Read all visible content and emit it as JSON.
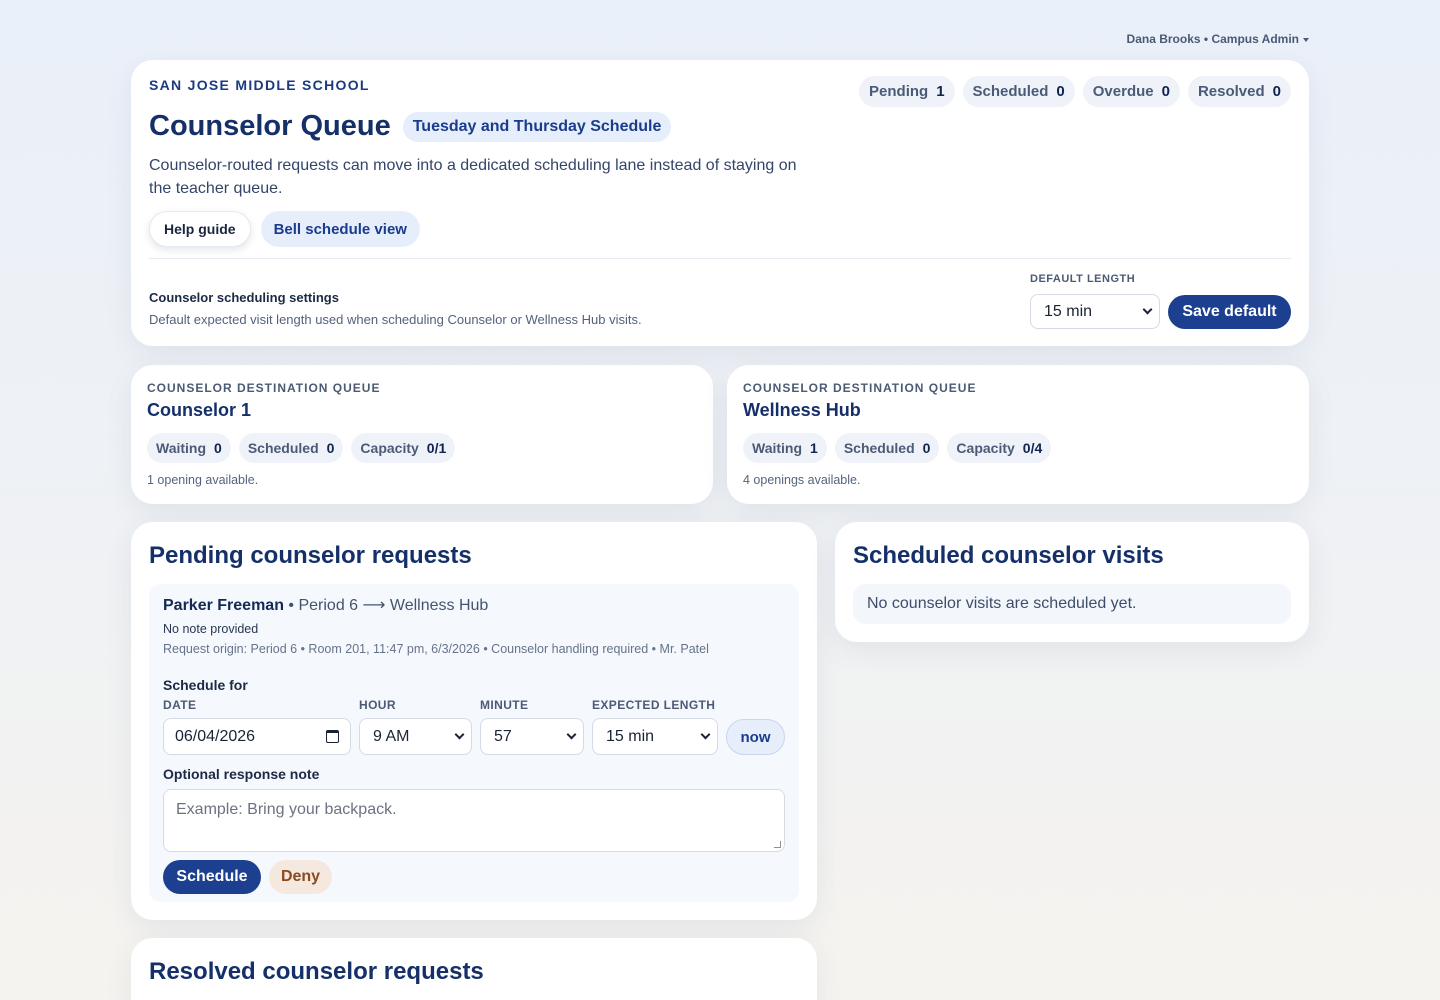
{
  "user_menu": {
    "label": "Dana Brooks • Campus Admin"
  },
  "header": {
    "school": "SAN JOSE MIDDLE SCHOOL",
    "title": "Counselor Queue",
    "schedule_pill": "Tuesday and Thursday Schedule",
    "description": "Counselor-routed requests can move into a dedicated scheduling lane instead of staying on the teacher queue.",
    "help_button": "Help guide",
    "bell_button": "Bell schedule view",
    "stats": [
      {
        "label": "Pending",
        "value": "1"
      },
      {
        "label": "Scheduled",
        "value": "0"
      },
      {
        "label": "Overdue",
        "value": "0"
      },
      {
        "label": "Resolved",
        "value": "0"
      }
    ]
  },
  "settings": {
    "title": "Counselor scheduling settings",
    "description": "Default expected visit length used when scheduling Counselor or Wellness Hub visits.",
    "default_length_label": "DEFAULT LENGTH",
    "default_length_value": "15 min",
    "save_button": "Save default"
  },
  "destinations": [
    {
      "kicker": "COUNSELOR DESTINATION QUEUE",
      "name": "Counselor 1",
      "chips": [
        {
          "label": "Waiting",
          "value": "0"
        },
        {
          "label": "Scheduled",
          "value": "0"
        },
        {
          "label": "Capacity",
          "value": "0/1"
        }
      ],
      "note": "1 opening available."
    },
    {
      "kicker": "COUNSELOR DESTINATION QUEUE",
      "name": "Wellness Hub",
      "chips": [
        {
          "label": "Waiting",
          "value": "1"
        },
        {
          "label": "Scheduled",
          "value": "0"
        },
        {
          "label": "Capacity",
          "value": "0/4"
        }
      ],
      "note": "4 openings available."
    }
  ],
  "pending": {
    "title": "Pending counselor requests",
    "request": {
      "student": "Parker Freeman",
      "route": " • Period 6 ⟶ Wellness Hub",
      "note": "No note provided",
      "origin": "Request origin: Period 6 • Room 201, 11:47 pm, 6/3/2026 • Counselor handling required • Mr. Patel",
      "schedule_label": "Schedule for",
      "date_label": "DATE",
      "date_value": "06/04/2026",
      "hour_label": "HOUR",
      "hour_value": "9 AM",
      "minute_label": "MINUTE",
      "minute_value": "57",
      "length_label": "EXPECTED LENGTH",
      "length_value": "15 min",
      "now_button": "now",
      "note_label": "Optional response note",
      "note_placeholder": "Example: Bring your backpack.",
      "schedule_button": "Schedule",
      "deny_button": "Deny"
    }
  },
  "scheduled": {
    "title": "Scheduled counselor visits",
    "empty": "No counselor visits are scheduled yet."
  },
  "resolved": {
    "title": "Resolved counselor requests"
  }
}
